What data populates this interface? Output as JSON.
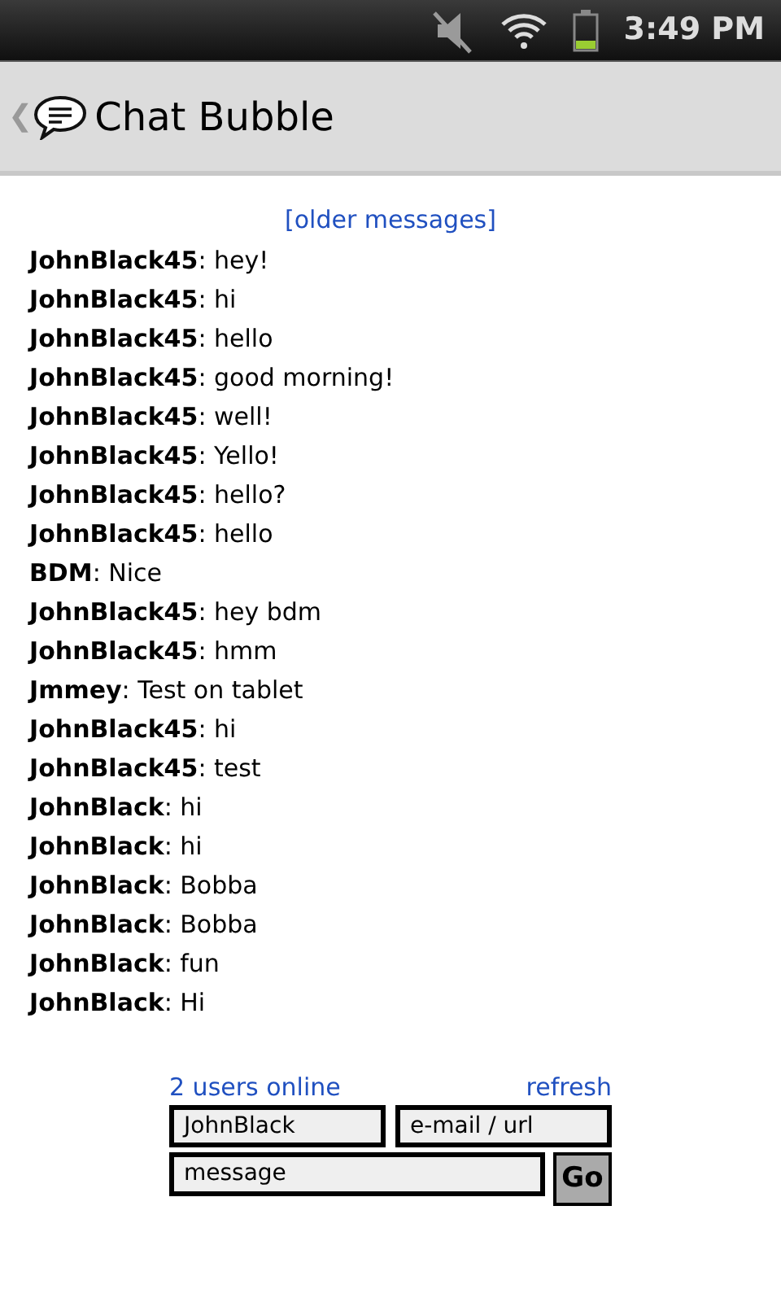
{
  "status_bar": {
    "time": "3:49 PM"
  },
  "title_bar": {
    "back": "❮",
    "title": "Chat Bubble"
  },
  "older_link": "[older messages]",
  "messages": [
    "**JohnBlack45**: hey!",
    "**JohnBlack45**: hi",
    "**JohnBlack45**: hello",
    "**JohnBlack45**: good morning!",
    "**JohnBlack45**: well!",
    "**JohnBlack45**: Yello!",
    "**JohnBlack45**: hello?",
    "**JohnBlack45**: hello",
    "**BDM**: Nice",
    "**JohnBlack45**: hey bdm",
    "**JohnBlack45**: hmm",
    "**Jmmey**: Test on tablet",
    "**JohnBlack45**: hi",
    "**JohnBlack45**: test",
    "**JohnBlack**: hi",
    "**JohnBlack**: hi",
    "**JohnBlack**: Bobba",
    "**JohnBlack**: Bobba",
    "**JohnBlack**: fun",
    "**JohnBlack**: Hi"
  ],
  "form": {
    "users_online": "2 users online",
    "refresh": "refresh",
    "name_field": {
      "value": "JohnBlack"
    },
    "url_field": {
      "value": "e-mail / url"
    },
    "message_field": {
      "value": "message"
    },
    "go_button": "Go"
  }
}
